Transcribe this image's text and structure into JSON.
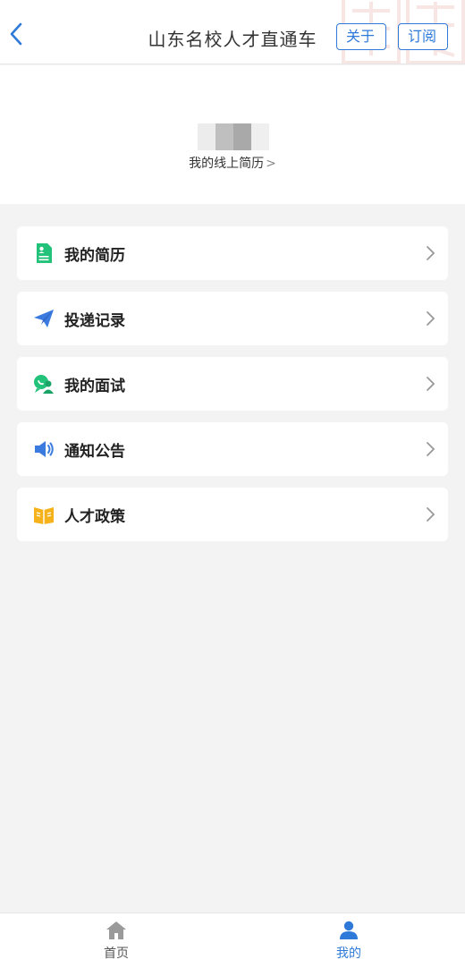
{
  "header": {
    "title": "山东名校人才直通车",
    "about_label": "关于",
    "subscribe_label": "订阅"
  },
  "profile": {
    "resume_link_label": "我的线上简历",
    "resume_link_chevron": ">"
  },
  "menu": {
    "items": [
      {
        "label": "我的简历",
        "icon": "resume-icon",
        "color": "#22c27a"
      },
      {
        "label": "投递记录",
        "icon": "paper-plane-icon",
        "color": "#3b7be0"
      },
      {
        "label": "我的面试",
        "icon": "interview-chat-icon",
        "color": "#22c27a"
      },
      {
        "label": "通知公告",
        "icon": "speaker-icon",
        "color": "#3b7be0"
      },
      {
        "label": "人才政策",
        "icon": "policy-book-icon",
        "color": "#f5b21b"
      }
    ]
  },
  "tabbar": {
    "tabs": [
      {
        "label": "首页",
        "icon": "home-icon",
        "active": false
      },
      {
        "label": "我的",
        "icon": "user-icon",
        "active": true
      }
    ]
  },
  "colors": {
    "accent": "#2f7ad9",
    "background": "#f3f3f3"
  }
}
